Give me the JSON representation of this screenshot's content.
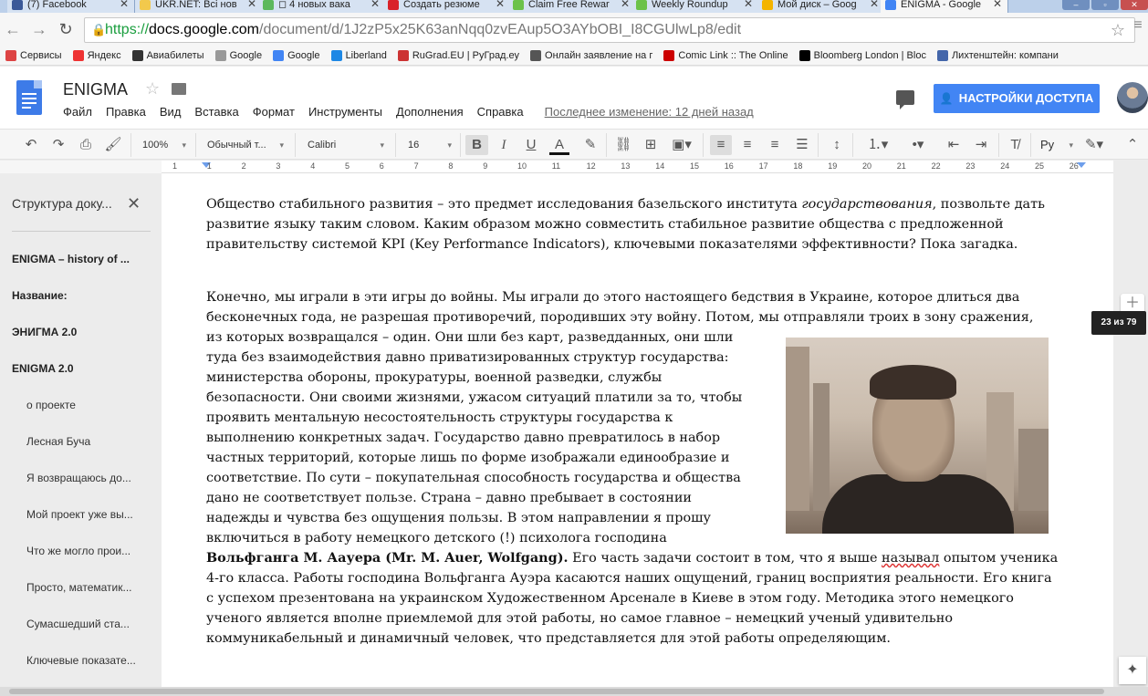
{
  "browser": {
    "tabs": [
      {
        "title": "(7) Facebook",
        "color": "#3b5998"
      },
      {
        "title": "UKR.NET: Всі нов",
        "color": "#f2c94c"
      },
      {
        "title": "◻ 4 новых вака",
        "color": "#5cb85c"
      },
      {
        "title": "Создать резюме",
        "color": "#d9222a"
      },
      {
        "title": "Claim Free Rewar",
        "color": "#6cc24a"
      },
      {
        "title": "Weekly Roundup",
        "color": "#6cc24a"
      },
      {
        "title": "Мой диск – Goog",
        "color": "#f4b400"
      },
      {
        "title": "ENIGMA - Google",
        "color": "#4285f4"
      }
    ],
    "url_protocol": "https://",
    "url_host": "docs.google.com",
    "url_path": "/document/d/1J2zP5x25K63anNqq0zvEAup5O3AYbOBI_I8CGUlwLp8/edit",
    "bookmarks": [
      {
        "label": "Сервисы",
        "icon": "apps-icon",
        "color": "#d44"
      },
      {
        "label": "Яндекс",
        "icon": "yandex-icon",
        "color": "#e33"
      },
      {
        "label": "Авиабилеты",
        "icon": "plane-icon",
        "color": "#333"
      },
      {
        "label": "Google",
        "icon": "page-icon",
        "color": "#999"
      },
      {
        "label": "Google",
        "icon": "google-icon",
        "color": "#4285f4"
      },
      {
        "label": "Liberland",
        "icon": "liberland-icon",
        "color": "#1e88e5"
      },
      {
        "label": "RuGrad.EU | РуГрад.еу",
        "icon": "rugrad-icon",
        "color": "#c33"
      },
      {
        "label": "Онлайн заявление на г",
        "icon": "form-icon",
        "color": "#555"
      },
      {
        "label": "Comic Link :: The Online",
        "icon": "comic-icon",
        "color": "#c00"
      },
      {
        "label": "Bloomberg London | Bloc",
        "icon": "bloomberg-icon",
        "color": "#000"
      },
      {
        "label": "Лихтенштейн: компани",
        "icon": "globe-icon",
        "color": "#46a"
      }
    ]
  },
  "doc": {
    "title": "ENIGMA",
    "menu": [
      "Файл",
      "Правка",
      "Вид",
      "Вставка",
      "Формат",
      "Инструменты",
      "Дополнения",
      "Справка"
    ],
    "last_edit": "Последнее изменение: 12 дней назад",
    "share_label": "НАСТРОЙКИ ДОСТУПА"
  },
  "format_toolbar": {
    "zoom": "100%",
    "style": "Обычный т...",
    "font": "Calibri",
    "size": "16",
    "lang": "Ру"
  },
  "ruler_numbers": [
    "1",
    "1",
    "2",
    "3",
    "4",
    "5",
    "6",
    "7",
    "8",
    "9",
    "10",
    "11",
    "12",
    "13",
    "14",
    "15",
    "16",
    "17",
    "18",
    "19",
    "20",
    "21",
    "22",
    "23",
    "24",
    "25",
    "26"
  ],
  "outline": {
    "title": "Структура доку...",
    "items": [
      {
        "label": "ENIGMA – history of ...",
        "level": 1
      },
      {
        "label": "Название:",
        "level": 1
      },
      {
        "label": "ЭНИГМА 2.0",
        "level": 1
      },
      {
        "label": "ENIGMA 2.0",
        "level": 1
      },
      {
        "label": "о проекте",
        "level": 2
      },
      {
        "label": "Лесная Буча",
        "level": 2
      },
      {
        "label": "Я возвращаюсь до...",
        "level": 2
      },
      {
        "label": "Мой проект уже вы...",
        "level": 2
      },
      {
        "label": "Что же могло прои...",
        "level": 2
      },
      {
        "label": "Просто, математик...",
        "level": 2
      },
      {
        "label": "Сумасшедший ста...",
        "level": 2
      },
      {
        "label": "Ключевые показате...",
        "level": 2
      }
    ]
  },
  "content": {
    "para1_a": "Общество стабильного развития – это предмет исследования базельского института ",
    "para1_italic": "государствования",
    "para1_b": ", позвольте дать развитие языку таким словом. Каким образом можно совместить стабильное развитие общества с предложенной правительству системой KPI (Key Performance Indicators), ключевыми  показателями эффективности? Пока загадка.",
    "para2_line1": "Конечно, мы играли в эти игры до войны. Мы играли до этого настоящего бедствия в Украине, которое длиться два",
    "para2_line2": "бесконечных года, не разрешая противоречий, породивших эту войну. Потом, мы отправляли троих в зону сражения,",
    "para2_wrapped": [
      "из которых возвращался – один. Они шли без карт, разведданных, они шли",
      "туда без взаимодействия давно приватизированных структур государства:",
      "министерства обороны, прокуратуры, военной разведки, службы",
      "безопасности. Они своими жизнями, ужасом ситуаций платили за то, чтобы",
      "проявить ментальную несостоятельность структуры государства к",
      "выполнению конкретных задач. Государство давно превратилось в набор",
      "частных территорий, которые лишь по форме изображали единообразие и",
      "соответствие. По сути – покупательная способность государства и общества",
      "дано не соответствует пользе. Страна – давно пребывает в состоянии",
      "надежды и чувства без ощущения пользы. В этом направлении я прошу",
      "включиться в работу немецкого детского (!) психолога господина"
    ],
    "para2_bold": "Вольфганга М. Аауера (Mr. M. Auer, Wolfgang).",
    "para2_after_bold_1": " Его часть задачи состоит в том, что я выше ",
    "para2_underlined": "называл",
    "para2_after_bold_2": " опытом ученика",
    "para2_tail": [
      "4-го класса. Работы господина Вольфганга Ауэра касаются наших ощущений, границ восприятия реальности. Его книга",
      "с успехом презентована на украинском Художественном Арсенале в Киеве в этом году. Методика этого немецкого",
      "ученого является вполне приемлемой для этой работы, но самое главное – немецкий ученый удивительно",
      "коммуникабельный и динамичный человек, что представляется для этой работы определяющим."
    ]
  },
  "page_indicator": "23 из 79"
}
